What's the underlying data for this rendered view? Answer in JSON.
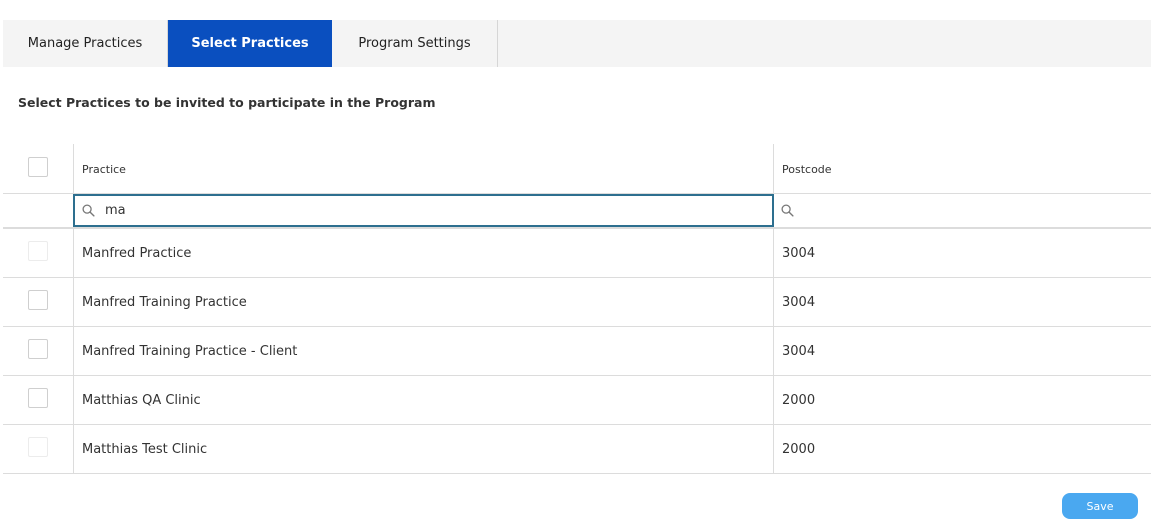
{
  "tabs": [
    {
      "label": "Manage Practices",
      "active": false
    },
    {
      "label": "Select Practices",
      "active": true
    },
    {
      "label": "Program Settings",
      "active": false
    }
  ],
  "heading": "Select Practices to be invited to participate in the Program",
  "table": {
    "columns": {
      "practice": "Practice",
      "postcode": "Postcode"
    },
    "filters": {
      "practice_value": "ma",
      "postcode_value": ""
    },
    "rows": [
      {
        "practice": "Manfred Practice",
        "postcode": "3004",
        "checked": false
      },
      {
        "practice": "Manfred Training Practice",
        "postcode": "3004",
        "checked": false
      },
      {
        "practice": "Manfred Training Practice - Client",
        "postcode": "3004",
        "checked": false
      },
      {
        "practice": "Matthias QA Clinic",
        "postcode": "2000",
        "checked": false
      },
      {
        "practice": "Matthias Test Clinic",
        "postcode": "2000",
        "checked": false
      }
    ]
  },
  "save_label": "Save",
  "icons": {
    "filter_search": "search-icon"
  },
  "colors": {
    "active_tab": "#0a4fbf",
    "save_button": "#4aa8f0",
    "focused_filter_border": "#2d6f8f"
  }
}
